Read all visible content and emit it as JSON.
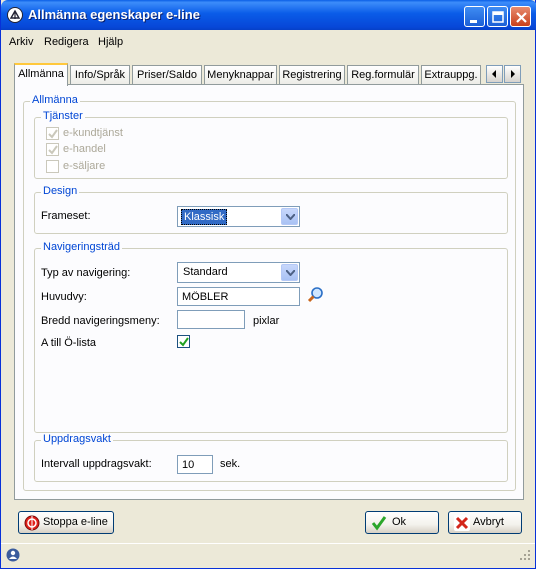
{
  "window": {
    "title": "Allmänna egenskaper e-line"
  },
  "menu": [
    {
      "label": "Arkiv"
    },
    {
      "label": "Redigera"
    },
    {
      "label": "Hjälp"
    }
  ],
  "tabs": [
    {
      "label": "Allmänna"
    },
    {
      "label": "Info/Språk"
    },
    {
      "label": "Priser/Saldo"
    },
    {
      "label": "Menyknappar"
    },
    {
      "label": "Registrering"
    },
    {
      "label": "Reg.formulär"
    },
    {
      "label": "Extrauppg."
    }
  ],
  "panel": {
    "group_title": "Allmänna",
    "services": {
      "title": "Tjänster",
      "items": [
        {
          "label": "e-kundtjänst",
          "checked": true
        },
        {
          "label": "e-handel",
          "checked": true
        },
        {
          "label": "e-säljare",
          "checked": false
        }
      ]
    },
    "design": {
      "title": "Design",
      "frameset_label": "Frameset:",
      "frameset_value": "Klassisk"
    },
    "navigation": {
      "title": "Navigeringsträd",
      "type_label": "Typ av navigering:",
      "type_value": "Standard",
      "main_view_label": "Huvudvy:",
      "main_view_value": "MÖBLER",
      "width_label": "Bredd navigeringsmeny:",
      "width_value": "",
      "width_unit": "pixlar",
      "az_label": "A till Ö-lista",
      "az_checked": true
    },
    "watchdog": {
      "title": "Uppdragsvakt",
      "interval_label": "Intervall uppdragsvakt:",
      "interval_value": "10",
      "interval_unit": "sek."
    }
  },
  "buttons": {
    "stop": "Stoppa e-line",
    "ok": "Ok",
    "cancel": "Avbryt"
  },
  "colors": {
    "title_bar": "#0a5ce8",
    "group_title": "#0046d5",
    "active_tab_accent": "#ffc83c"
  }
}
